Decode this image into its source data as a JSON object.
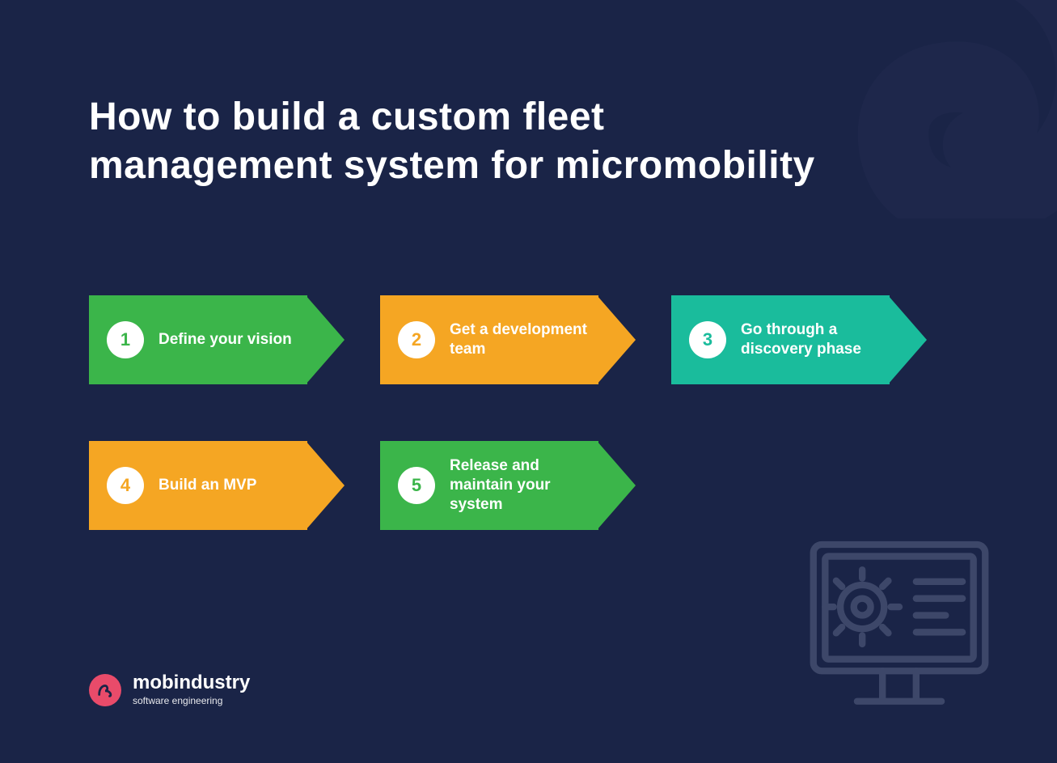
{
  "title": "How to build a custom fleet management system for micromobility",
  "steps": [
    {
      "num": "1",
      "label": "Define your vision",
      "color": "green"
    },
    {
      "num": "2",
      "label": "Get a development team",
      "color": "orange"
    },
    {
      "num": "3",
      "label": "Go through a discovery phase",
      "color": "teal"
    },
    {
      "num": "4",
      "label": "Build an MVP",
      "color": "orange"
    },
    {
      "num": "5",
      "label": "Release and maintain your system",
      "color": "green"
    }
  ],
  "logo": {
    "name": "mobindustry",
    "tagline": "software engineering"
  },
  "colors": {
    "background": "#1a2447",
    "green": "#3bb54a",
    "orange": "#f5a623",
    "teal": "#1abc9c",
    "logo_mark": "#e94b6a"
  },
  "icons": {
    "corner": "swirl-icon",
    "bottom_right": "computer-settings-icon",
    "logo_mark": "mobindustry-mark-icon"
  }
}
